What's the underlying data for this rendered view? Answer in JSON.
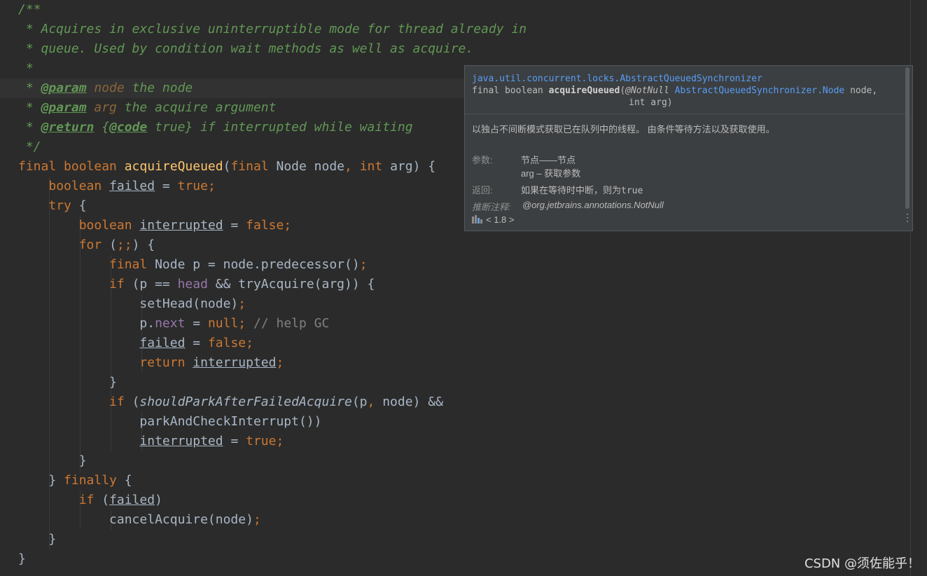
{
  "code_lines": [
    [
      {
        "t": "/**",
        "c": "tok-doc"
      }
    ],
    [
      {
        "t": " * Acquires in exclusive uninterruptible mode for thread already in",
        "c": "tok-doc"
      }
    ],
    [
      {
        "t": " * queue. Used by condition wait methods as well as acquire.",
        "c": "tok-doc"
      }
    ],
    [
      {
        "t": " *",
        "c": "tok-doc"
      }
    ],
    [
      {
        "t": " * ",
        "c": "tok-doc"
      },
      {
        "t": "@param",
        "c": "tok-tag"
      },
      {
        "t": " node",
        "c": "tok-docp"
      },
      {
        "t": " the node",
        "c": "tok-doc"
      }
    ],
    [
      {
        "t": " * ",
        "c": "tok-doc"
      },
      {
        "t": "@param",
        "c": "tok-tag"
      },
      {
        "t": " arg",
        "c": "tok-docp"
      },
      {
        "t": " the acquire argument",
        "c": "tok-doc"
      }
    ],
    [
      {
        "t": " * ",
        "c": "tok-doc"
      },
      {
        "t": "@return",
        "c": "tok-tag"
      },
      {
        "t": " {",
        "c": "tok-doc"
      },
      {
        "t": "@code",
        "c": "tok-tag"
      },
      {
        "t": " true} if interrupted while waiting",
        "c": "tok-doc"
      }
    ],
    [
      {
        "t": " */",
        "c": "tok-doc"
      }
    ],
    [
      {
        "t": "final boolean ",
        "c": "tok-kw"
      },
      {
        "t": "acquireQueued",
        "c": "tok-fn"
      },
      {
        "t": "("
      },
      {
        "t": "final ",
        "c": "tok-kw"
      },
      {
        "t": "Node node"
      },
      {
        "t": ", ",
        "c": "tok-kw"
      },
      {
        "t": "int ",
        "c": "tok-kw"
      },
      {
        "t": "arg) {"
      }
    ],
    [
      {
        "t": "    "
      },
      {
        "t": "boolean ",
        "c": "tok-kw"
      },
      {
        "t": "failed",
        "c": "tok-u"
      },
      {
        "t": " = "
      },
      {
        "t": "true;",
        "c": "tok-kw"
      }
    ],
    [
      {
        "t": "    "
      },
      {
        "t": "try ",
        "c": "tok-kw"
      },
      {
        "t": "{"
      }
    ],
    [
      {
        "t": "        "
      },
      {
        "t": "boolean ",
        "c": "tok-kw"
      },
      {
        "t": "interrupted",
        "c": "tok-u"
      },
      {
        "t": " = "
      },
      {
        "t": "false;",
        "c": "tok-kw"
      }
    ],
    [
      {
        "t": "        "
      },
      {
        "t": "for ",
        "c": "tok-kw"
      },
      {
        "t": "("
      },
      {
        "t": ";;",
        "c": "tok-kw"
      },
      {
        "t": ") {"
      }
    ],
    [
      {
        "t": "            "
      },
      {
        "t": "final ",
        "c": "tok-kw"
      },
      {
        "t": "Node p = node.predecessor()"
      },
      {
        "t": ";",
        "c": "tok-kw"
      }
    ],
    [
      {
        "t": "            "
      },
      {
        "t": "if ",
        "c": "tok-kw"
      },
      {
        "t": "(p == "
      },
      {
        "t": "head",
        "c": "tok-field"
      },
      {
        "t": " && tryAcquire(arg)) {"
      }
    ],
    [
      {
        "t": "                setHead(node)"
      },
      {
        "t": ";",
        "c": "tok-kw"
      }
    ],
    [
      {
        "t": "                p."
      },
      {
        "t": "next",
        "c": "tok-field"
      },
      {
        "t": " = "
      },
      {
        "t": "null; ",
        "c": "tok-kw"
      },
      {
        "t": "// help GC",
        "c": "tok-cmt"
      }
    ],
    [
      {
        "t": "                "
      },
      {
        "t": "failed",
        "c": "tok-u"
      },
      {
        "t": " = "
      },
      {
        "t": "false;",
        "c": "tok-kw"
      }
    ],
    [
      {
        "t": "                "
      },
      {
        "t": "return ",
        "c": "tok-kw"
      },
      {
        "t": "interrupted",
        "c": "tok-u"
      },
      {
        "t": ";",
        "c": "tok-kw"
      }
    ],
    [
      {
        "t": "            }"
      }
    ],
    [
      {
        "t": "            "
      },
      {
        "t": "if ",
        "c": "tok-kw"
      },
      {
        "t": "("
      },
      {
        "t": "shouldParkAfterFailedAcquire",
        "c": "tok-it"
      },
      {
        "t": "(p"
      },
      {
        "t": ", ",
        "c": "tok-kw"
      },
      {
        "t": "node) &&"
      }
    ],
    [
      {
        "t": "                parkAndCheckInterrupt())"
      }
    ],
    [
      {
        "t": "                "
      },
      {
        "t": "interrupted",
        "c": "tok-u"
      },
      {
        "t": " = "
      },
      {
        "t": "true;",
        "c": "tok-kw"
      }
    ],
    [
      {
        "t": "        }"
      }
    ],
    [
      {
        "t": "    } "
      },
      {
        "t": "finally ",
        "c": "tok-kw"
      },
      {
        "t": "{"
      }
    ],
    [
      {
        "t": "        "
      },
      {
        "t": "if ",
        "c": "tok-kw"
      },
      {
        "t": "("
      },
      {
        "t": "failed",
        "c": "tok-u"
      },
      {
        "t": ")"
      }
    ],
    [
      {
        "t": "            cancelAcquire(node)"
      },
      {
        "t": ";",
        "c": "tok-kw"
      }
    ],
    [
      {
        "t": "    }"
      }
    ],
    [
      {
        "t": "}"
      }
    ]
  ],
  "popup": {
    "class_path": "java.util.concurrent.locks.AbstractQueuedSynchronizer",
    "sig_prefix": "final boolean ",
    "sig_method": "acquireQueued",
    "sig_open": "(",
    "sig_annotation": "@NotNull",
    "sig_type": "AbstractQueuedSynchronizer.Node",
    "sig_param1": " node,",
    "sig_line2": "int arg)",
    "description": "以独占不间断模式获取已在队列中的线程。 由条件等待方法以及获取使用。",
    "params_label": "参数:",
    "param1": "节点——节点",
    "param2": "arg – 获取参数",
    "return_label": "返回:",
    "return_text": "如果在等待时中断，则为",
    "return_code": "true",
    "inferred_label": "推断注释:",
    "inferred_value": "@org.jetbrains.annotations.NotNull",
    "version": "< 1.8 >",
    "menu_glyph": "⋮"
  },
  "watermark": "CSDN @须佐能乎！"
}
